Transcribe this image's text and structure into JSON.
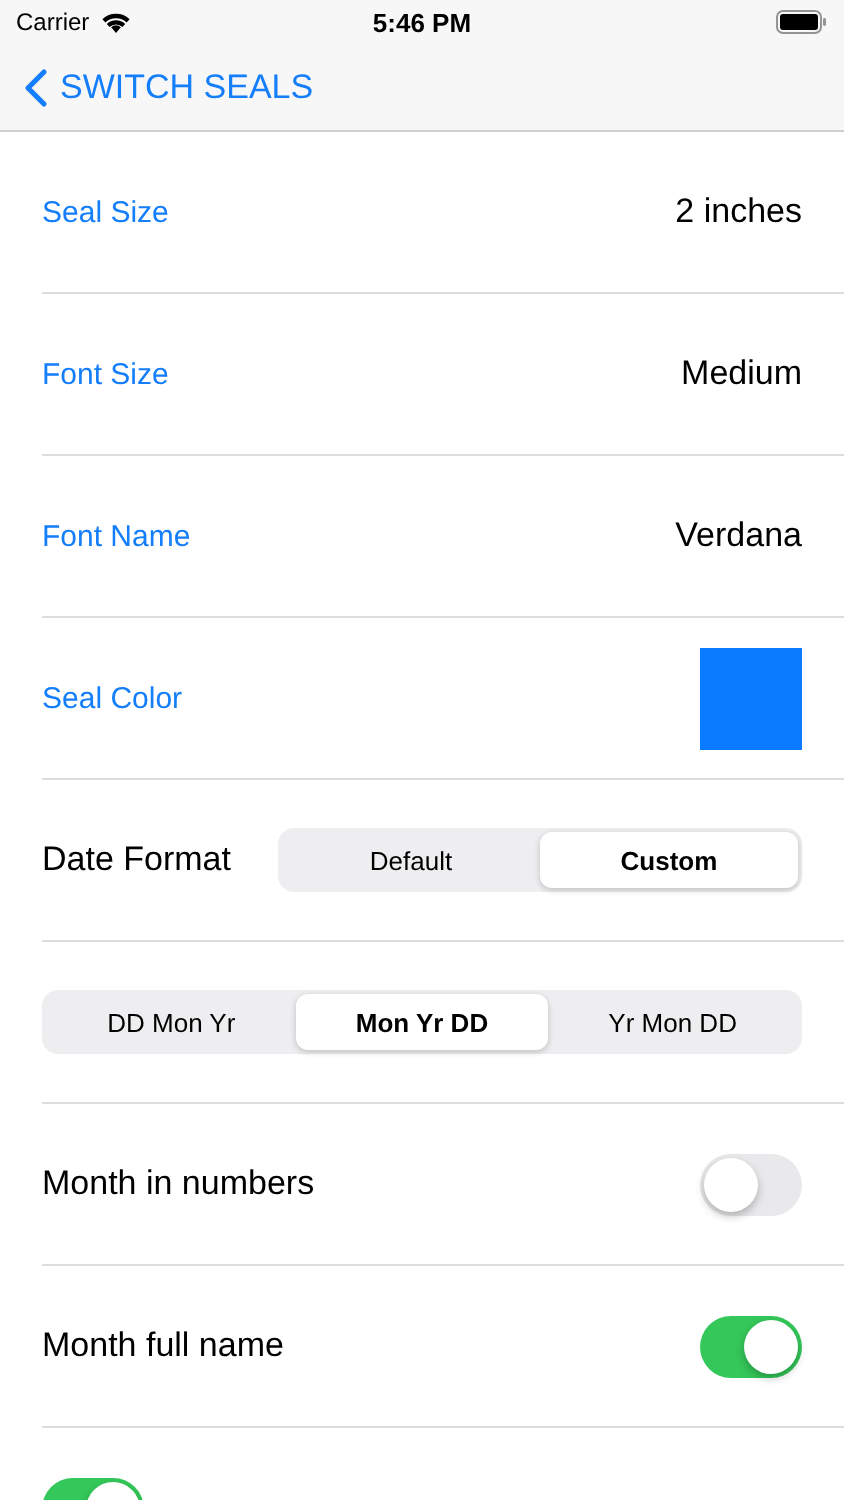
{
  "status_bar": {
    "carrier": "Carrier",
    "time": "5:46 PM"
  },
  "nav": {
    "back_label": "SWITCH SEALS"
  },
  "rows": [
    {
      "kind": "value",
      "label": "Seal Size",
      "value": "2 inches"
    },
    {
      "kind": "value",
      "label": "Font Size",
      "value": "Medium"
    },
    {
      "kind": "value",
      "label": "Font Name",
      "value": "Verdana"
    },
    {
      "kind": "color",
      "label": "Seal Color",
      "color": "#0a7aff"
    },
    {
      "kind": "segmented",
      "label": "Date Format",
      "segments": [
        {
          "label": "Default",
          "selected": false
        },
        {
          "label": "Custom",
          "selected": true
        }
      ]
    },
    {
      "kind": "segmented",
      "segments": [
        {
          "label": "DD Mon Yr",
          "selected": false
        },
        {
          "label": "Mon Yr DD",
          "selected": true
        },
        {
          "label": "Yr Mon DD",
          "selected": false
        }
      ]
    },
    {
      "kind": "toggle",
      "label": "Month in numbers",
      "on": false
    },
    {
      "kind": "toggle",
      "label": "Month full name",
      "on": true
    },
    {
      "kind": "toggle",
      "on": true
    }
  ]
}
